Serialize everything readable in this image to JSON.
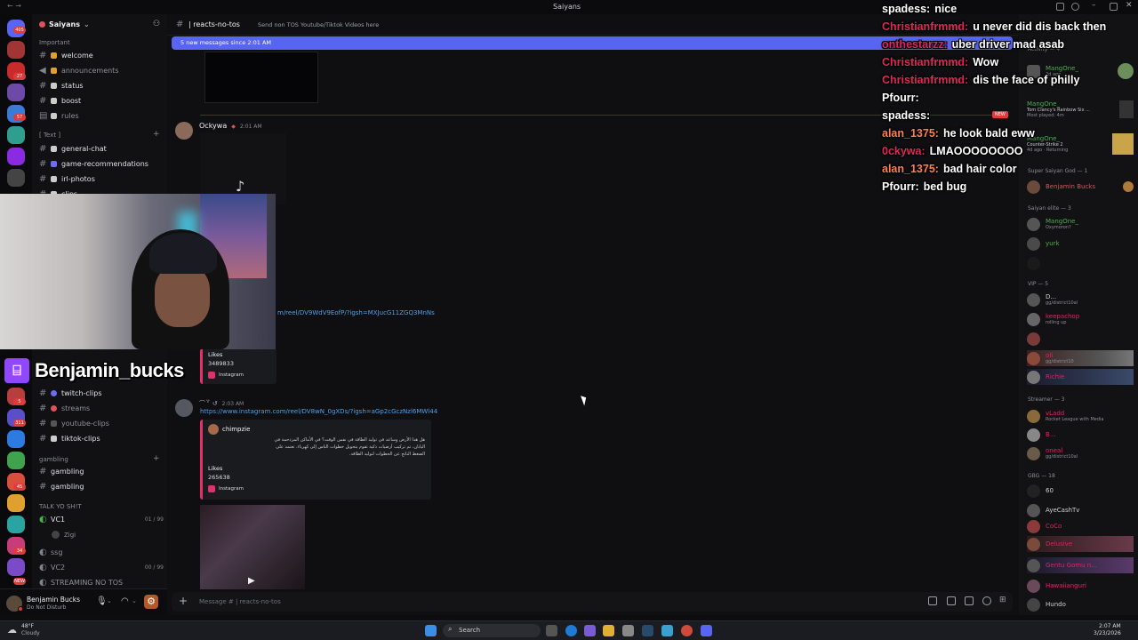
{
  "titlebar": {
    "title": "Saiyans"
  },
  "rail": {
    "badges": [
      "405",
      "27",
      "57",
      "5",
      "311",
      "45",
      "34",
      "NEW"
    ]
  },
  "sidebar": {
    "server_name": "Saiyans",
    "categories": {
      "important": "Important",
      "text": "[ Text ]",
      "gambling": "gambling",
      "voice": "TALK YO SH!T"
    },
    "channels": [
      {
        "label": "welcome"
      },
      {
        "label": "announcements"
      },
      {
        "label": "status"
      },
      {
        "label": "boost"
      },
      {
        "label": "rules"
      },
      {
        "label": "general-chat"
      },
      {
        "label": "game-recommendations"
      },
      {
        "label": "irl-photos"
      },
      {
        "label": "clips"
      },
      {
        "label": "twitch-clips"
      },
      {
        "label": "streams"
      },
      {
        "label": "youtube-clips"
      },
      {
        "label": "tiktok-clips"
      },
      {
        "label": "gambling"
      },
      {
        "label": "gambling"
      }
    ],
    "voice": [
      {
        "label": "VC1",
        "count": "01 / 99"
      },
      {
        "label": "Zigi"
      },
      {
        "label": "ssg"
      },
      {
        "label": "VC2",
        "count": "00 / 99"
      },
      {
        "label": "STREAMING NO TOS"
      }
    ]
  },
  "user": {
    "name": "Benjamin Bucks",
    "status": "Do Not Disturb"
  },
  "channel_header": {
    "name": "reacts-no-tos",
    "topic": "Send non TOS Youtube/Tiktok Videos here"
  },
  "new_messages_bar": "5 new messages since 2:01 AM",
  "messages": [
    {
      "author": "Ockywa",
      "time": "2:01 AM",
      "link": "m/reel/DV9WdV9EofP/?igsh=MXJucG11ZGQ3MnNs",
      "embed_likes_label": "Likes",
      "embed_likes": "3489833",
      "embed_source": "Instagram"
    },
    {
      "time": "2:03 AM",
      "link": "https://www.instagram.com/reel/DV8wN_0gXDs/?igsh=aGp2cGczNzl6MWl44",
      "embed_author": "chimpzie",
      "embed_text": "هل هذا الأرض وساعد في توليد الطاقة في نفس الوقت؟ في الأماكن المزدحمة في اليابان، تم تركيب أرضيات ذكية تقوم بتحويل خطوات الناس إلى كهرباء. تعتمد على الضغط الناتج عن الخطوات لتوليد الطاقة.",
      "embed_likes_label": "Likes",
      "embed_likes": "265638",
      "embed_source": "Instagram"
    }
  ],
  "composer": {
    "placeholder": "Message #  |  reacts-no-tos"
  },
  "members": {
    "activity_header": "Activity — 4",
    "activity": [
      {
        "name": "MangOne_",
        "status": "2d ago"
      },
      {
        "name": "MangOne_",
        "status": "Tom Clancy's Rainbow Six ...",
        "sub": "Most played: 4m"
      },
      {
        "name": "MangOne_",
        "status": "Counter-Strike 2",
        "sub": "4d ago · Returning"
      }
    ],
    "groups": [
      {
        "header": "Super Saiyan God — 1",
        "items": [
          {
            "name": "Benjamin Bucks",
            "color": "#e0525a"
          }
        ]
      },
      {
        "header": "Saiyan elite — 3",
        "items": [
          {
            "name": "MangOne_",
            "color": "#4caf50",
            "status": "Oxymoron?"
          },
          {
            "name": "yurk",
            "color": "#4caf50"
          },
          {
            "name": "",
            "color": "#4caf50"
          }
        ]
      },
      {
        "header": "VIP — 5",
        "items": [
          {
            "name": "D...",
            "color": "#d0d0d0",
            "status": "gg/district10al"
          },
          {
            "name": "keepachop",
            "color": "#e91e63",
            "status": "rolling up"
          },
          {
            "name": "",
            "color": "#e91e63"
          },
          {
            "name": "oli",
            "color": "#e91e63",
            "status": "gg/district10"
          },
          {
            "name": "Richie",
            "color": "#e91e63"
          }
        ]
      },
      {
        "header": "Streamer — 3",
        "items": [
          {
            "name": "vLadd",
            "color": "#e91e63",
            "status": "Rocket League with Media"
          },
          {
            "name": "B...",
            "color": "#e91e63"
          },
          {
            "name": "oneal",
            "color": "#e91e63",
            "status": "gg/district10al"
          }
        ]
      },
      {
        "header": "GBG — 18",
        "items": [
          {
            "name": "60",
            "color": "#d0d0d0"
          },
          {
            "name": "AyeCashTv",
            "color": "#d0d0d0"
          },
          {
            "name": "CoCo",
            "color": "#e91e63"
          },
          {
            "name": "Delusive",
            "color": "#e91e63"
          },
          {
            "name": "Gentu Gomu n...",
            "color": "#e91e63"
          },
          {
            "name": "Hawaiianguri",
            "color": "#e91e63"
          },
          {
            "name": "Hundo",
            "color": "#d0d0d0"
          }
        ]
      }
    ]
  },
  "overlay": {
    "streamer_name": "Benjamin_bucks",
    "chat": [
      {
        "user": "spadess:",
        "msg": "nice",
        "color": "#ffffff"
      },
      {
        "user": "Christianfrmmd:",
        "msg": "u never did dis back then",
        "color": "#e0245e"
      },
      {
        "user": "onthestarzz:",
        "msg": "uber driver mad asab",
        "color": "#e0245e"
      },
      {
        "user": "Christianfrmmd:",
        "msg": "Wow",
        "color": "#e0245e"
      },
      {
        "user": "Christianfrmmd:",
        "msg": "dis the face of philly",
        "color": "#e0245e"
      },
      {
        "user": "Pfourr:",
        "msg": "",
        "color": "#ffffff"
      },
      {
        "user": "spadess:",
        "msg": "",
        "color": "#ffffff"
      },
      {
        "user": "alan_1375:",
        "msg": "he look bald eww",
        "color": "#ff7f50"
      },
      {
        "user": "0ckywa:",
        "msg": "LMAOOOOOOOO",
        "color": "#e0245e"
      },
      {
        "user": "alan_1375:",
        "msg": "bad hair color",
        "color": "#ff7f50"
      },
      {
        "user": "Pfourr:",
        "msg": "bed bug",
        "color": "#ffffff"
      }
    ]
  },
  "taskbar": {
    "weather_temp": "48°F",
    "weather_desc": "Cloudy",
    "search_label": "Search",
    "time": "2:07 AM",
    "date": "3/23/2026"
  }
}
